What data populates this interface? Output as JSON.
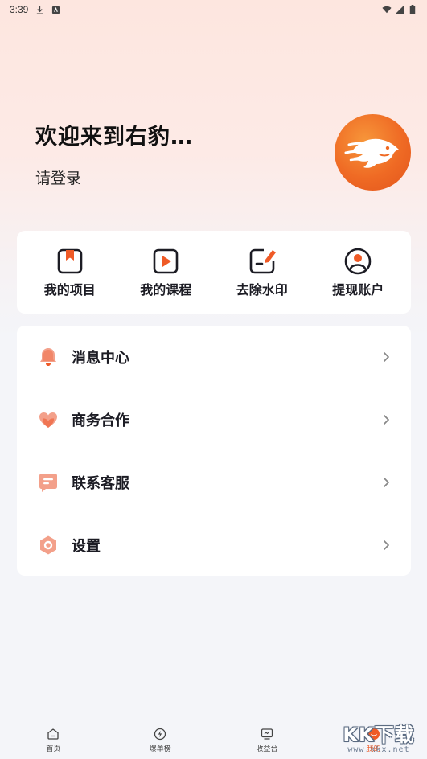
{
  "status_bar": {
    "time": "3:39"
  },
  "header": {
    "welcome_text": "欢迎来到右豹…",
    "login_text": "请登录"
  },
  "quick_actions": [
    {
      "label": "我的项目",
      "icon": "bookmark-icon"
    },
    {
      "label": "我的课程",
      "icon": "play-icon"
    },
    {
      "label": "去除水印",
      "icon": "edit-icon"
    },
    {
      "label": "提现账户",
      "icon": "user-icon"
    }
  ],
  "menu": [
    {
      "label": "消息中心",
      "icon": "bell-icon"
    },
    {
      "label": "商务合作",
      "icon": "heart-icon"
    },
    {
      "label": "联系客服",
      "icon": "chat-icon"
    },
    {
      "label": "设置",
      "icon": "settings-icon"
    }
  ],
  "tabs": [
    {
      "label": "首页",
      "icon": "home-icon",
      "active": false
    },
    {
      "label": "爆单榜",
      "icon": "lightning-icon",
      "active": false
    },
    {
      "label": "收益台",
      "icon": "monitor-icon",
      "active": false
    },
    {
      "label": "我的",
      "icon": "profile-icon",
      "active": true
    }
  ],
  "watermark": {
    "text": "KK下载",
    "sub": "www.kkx.net"
  },
  "colors": {
    "accent": "#ef5a26",
    "text_primary": "#1c1c24",
    "background": "#f4f5f9",
    "card": "#ffffff"
  }
}
